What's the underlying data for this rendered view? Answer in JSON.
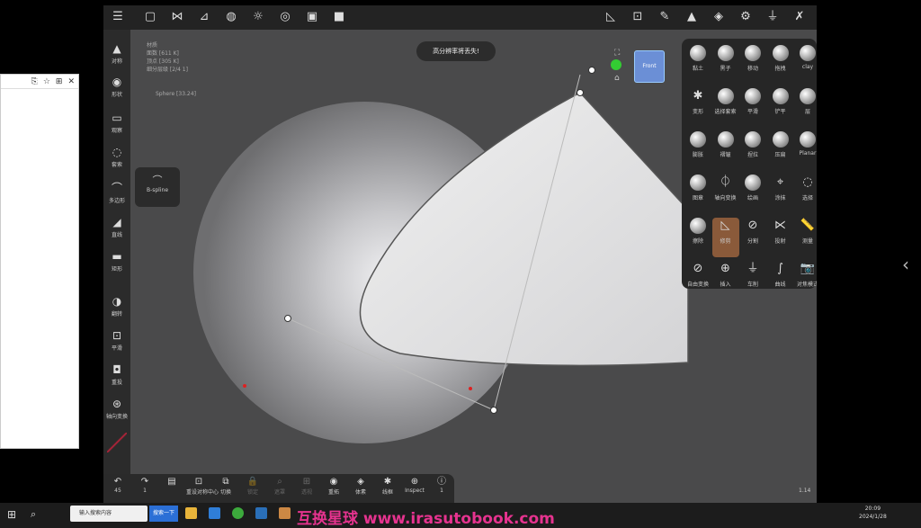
{
  "desktop_window": {
    "controls": [
      "⎘",
      "☆",
      "⊞",
      "✕"
    ]
  },
  "app": {
    "top_toolbar_icons": [
      "menu-icon",
      "folder-icon",
      "scene-icon",
      "layers-icon",
      "shading-icon",
      "sun-icon",
      "material-icon",
      "image-icon",
      "video-icon"
    ],
    "top_right_icons": [
      "measure-icon",
      "snap-icon",
      "brush-icon",
      "triangle-icon",
      "stack-icon",
      "gear-icon",
      "pin-icon",
      "wrench-icon"
    ],
    "info_lines": [
      "材质",
      "面数 [611 K]",
      "顶点 [305 K]",
      "细分层级 [2/4 1]"
    ],
    "object_label": "Sphere [33.24]",
    "toast": "高分辨率将丢失!",
    "view_cube": "Front",
    "left_tools": [
      {
        "label": "对称"
      },
      {
        "label": "形状"
      },
      {
        "label": "观察"
      },
      {
        "label": "套索"
      },
      {
        "label": "多边形"
      },
      {
        "label": "直线"
      },
      {
        "label": "矩形"
      },
      {
        "label": "翻转"
      },
      {
        "label": "平滑"
      },
      {
        "label": "重投"
      },
      {
        "label": "轴向变换"
      }
    ],
    "bspline_popup": "B-spline",
    "bottom_tools": [
      {
        "label": "45",
        "icon": "↶"
      },
      {
        "label": "1",
        "icon": "↷"
      },
      {
        "label": "",
        "icon": "▤"
      },
      {
        "label": "重设对称中心",
        "icon": "⊡"
      },
      {
        "label": "切换",
        "icon": "⧉"
      },
      {
        "label": "锁定",
        "icon": "🔒"
      },
      {
        "label": "遮罩",
        "icon": "⌕"
      },
      {
        "label": "透视",
        "icon": "⊞"
      },
      {
        "label": "重拓",
        "icon": "◉"
      },
      {
        "label": "体素",
        "icon": "◈"
      },
      {
        "label": "线框",
        "icon": "✱"
      },
      {
        "label": "Inspect",
        "icon": "⊕"
      },
      {
        "label": "1",
        "icon": "ⓘ"
      }
    ],
    "tool_panel": [
      {
        "label": "黏土",
        "glyph": ""
      },
      {
        "label": "黑子",
        "glyph": ""
      },
      {
        "label": "移动",
        "glyph": ""
      },
      {
        "label": "拖拽",
        "glyph": ""
      },
      {
        "label": "clay",
        "glyph": ""
      },
      {
        "label": "变形",
        "glyph": "✱"
      },
      {
        "label": "选择套索",
        "glyph": ""
      },
      {
        "label": "平滑",
        "glyph": ""
      },
      {
        "label": "铲平",
        "glyph": ""
      },
      {
        "label": "层",
        "glyph": ""
      },
      {
        "label": "膨胀",
        "glyph": ""
      },
      {
        "label": "褶皱",
        "glyph": ""
      },
      {
        "label": "捏拉",
        "glyph": ""
      },
      {
        "label": "压扁",
        "glyph": ""
      },
      {
        "label": "Planar",
        "glyph": ""
      },
      {
        "label": "图章",
        "glyph": ""
      },
      {
        "label": "轴向变换",
        "glyph": "⏀"
      },
      {
        "label": "绘画",
        "glyph": ""
      },
      {
        "label": "涂抹",
        "glyph": "⌖"
      },
      {
        "label": "选择",
        "glyph": "◌"
      },
      {
        "label": "擦除",
        "glyph": ""
      },
      {
        "label": "修剪",
        "glyph": "◺"
      },
      {
        "label": "分割",
        "glyph": "⊘"
      },
      {
        "label": "投射",
        "glyph": "⋉"
      },
      {
        "label": "测量",
        "glyph": "📏"
      },
      {
        "label": "自由变换",
        "glyph": "⊘"
      },
      {
        "label": "插入",
        "glyph": "⊕"
      },
      {
        "label": "车削",
        "glyph": "⏚"
      },
      {
        "label": "曲线",
        "glyph": "∫"
      },
      {
        "label": "对焦模式",
        "glyph": "📷"
      }
    ],
    "version": "1.14"
  },
  "taskbar": {
    "search_placeholder": "输入搜索内容",
    "search_button": "搜索一下",
    "watermark": "互换星球 www.irasutobook.com",
    "time": "20:09",
    "date": "2024/1/28"
  },
  "colors": {
    "accent": "#8a5a3a",
    "watermark": "#e6338f"
  }
}
